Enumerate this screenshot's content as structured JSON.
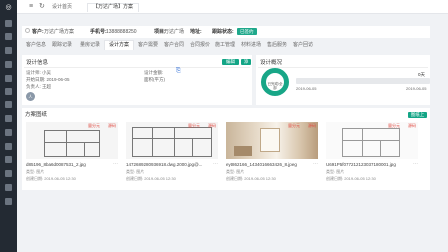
{
  "sidebar": {
    "logo": "◎",
    "icons": [
      "home-icon",
      "user-icon",
      "list-icon",
      "grid-icon",
      "chart-icon",
      "file-icon",
      "settings-icon",
      "box-icon",
      "shield-icon",
      "calendar-icon",
      "message-icon",
      "tag-icon",
      "report-icon",
      "help-icon"
    ]
  },
  "topbar": {
    "menu_icon": "≡",
    "refresh_icon": "↻",
    "tabs": [
      {
        "label": "设计首页"
      },
      {
        "label": "【万达广场】方案"
      }
    ]
  },
  "customer": {
    "name_label": "客户:",
    "name_value": "万达广场方案",
    "phone_label": "手机号:",
    "phone_value": "13888888250",
    "project_label": "项目:",
    "project_value": "万达广场",
    "address_label": "地址:",
    "designer_label": "跟踪状态:",
    "status_badge": "已签约"
  },
  "tabs": [
    {
      "label": "客户信息"
    },
    {
      "label": "跟踪记录"
    },
    {
      "label": "量房记录"
    },
    {
      "label": "设计方案"
    },
    {
      "label": "客户需要"
    },
    {
      "label": "客户合同"
    },
    {
      "label": "合同报价"
    },
    {
      "label": "施工管理"
    },
    {
      "label": "材料进场"
    },
    {
      "label": "售后服务"
    },
    {
      "label": "客户回访"
    }
  ],
  "design_info": {
    "title": "设计信息",
    "btn_edit": "编辑信息",
    "btn_add": "添加设计",
    "designer": "设计师: 小吴",
    "start_date": "开始日期: 2019-06-05",
    "assistant": "负责人: 王超",
    "design_fee": "设计金额:",
    "space_area": "面积(平方)",
    "avatar_label": "人"
  },
  "design_progress": {
    "title": "设计概况",
    "ring_label": "已完成/全部",
    "days": "0天",
    "start": "2019-06-05",
    "end": "2019-06-05",
    "progress": 0
  },
  "drawings": {
    "title": "方案图纸",
    "upload_button": "图纸上传",
    "items": [
      {
        "name": "d85196_8ba6d0087531_2.jpg",
        "price": "量分元",
        "stage": "源码",
        "type": "类型: 图片",
        "date": "创建日期: 2019-06-05 12:30"
      },
      {
        "name": "1472689280936918.dwg.2000.jpg@...",
        "price": "量分元",
        "stage": "源码",
        "type": "类型: 图片",
        "date": "创建日期: 2019-06-05 12:30"
      },
      {
        "name": "eyt862166_1434016663426_8.jpeg",
        "price": "量分元",
        "stage": "源码",
        "type": "类型: 图片",
        "date": "创建日期: 2019-06-05 12:30"
      },
      {
        "name": "U691P5f077212123037180001.jpg",
        "price": "量分元",
        "stage": "源码",
        "type": "类型: 图片",
        "date": "创建日期: 2019-06-05 12:30"
      }
    ]
  },
  "colors": {
    "accent": "#13a586",
    "sidebar": "#232a33",
    "price": "#e0483f",
    "upload": "#2a6ad6"
  }
}
